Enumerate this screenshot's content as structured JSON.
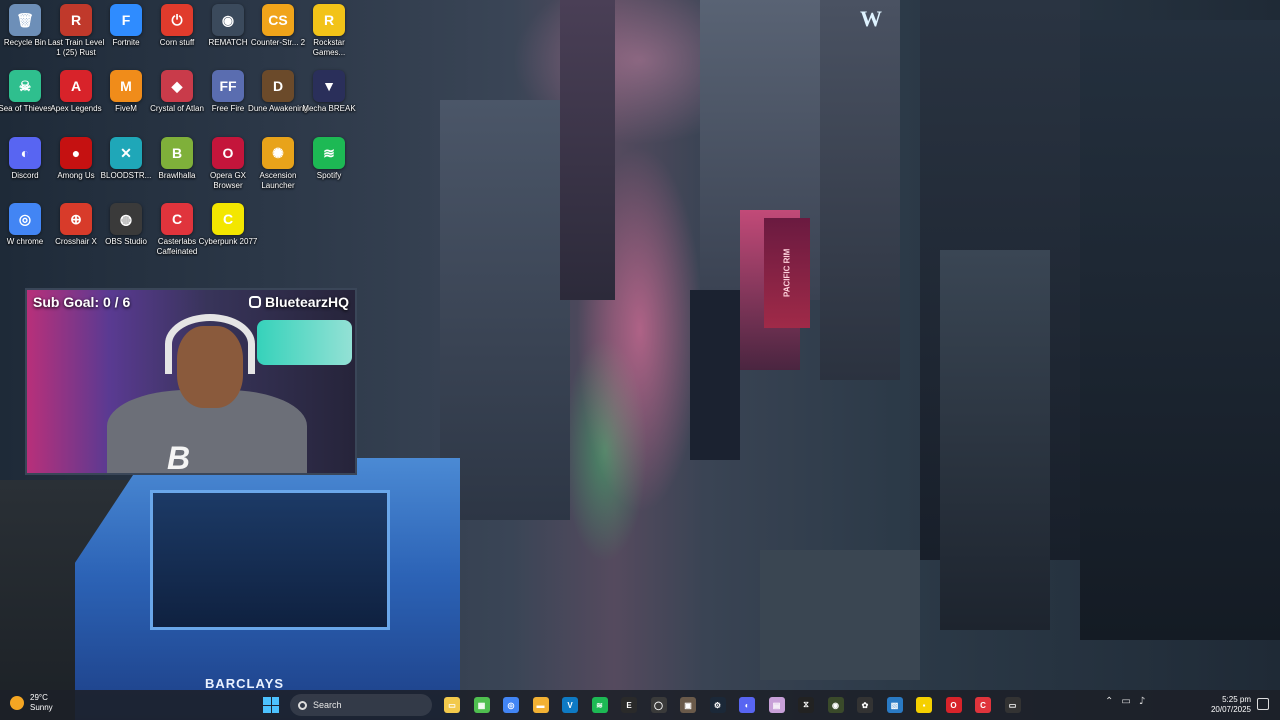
{
  "desktop": {
    "icons": [
      {
        "label": "Recycle Bin",
        "icon": "recycle-bin-icon",
        "color": "#6d8fb8",
        "glyph": "🗑"
      },
      {
        "label": "Last Train Level 1 (25) Rust",
        "icon": "rust-icon",
        "color": "#c0392b",
        "glyph": "R"
      },
      {
        "label": "Fortnite",
        "icon": "fortnite-icon",
        "color": "#2f8cff",
        "glyph": "F"
      },
      {
        "label": "Corn stuff",
        "icon": "power-icon",
        "color": "#e03b2c",
        "glyph": "⏻"
      },
      {
        "label": "REMATCH",
        "icon": "rematch-icon",
        "color": "#3b4a5c",
        "glyph": "◉"
      },
      {
        "label": "Counter-Str... 2",
        "icon": "counter-strike-icon",
        "color": "#f0a41a",
        "glyph": "CS"
      },
      {
        "label": "Rockstar Games...",
        "icon": "rockstar-icon",
        "color": "#f2c318",
        "glyph": "R"
      },
      {
        "label": "Sea of Thieves",
        "icon": "sea-of-thieves-icon",
        "color": "#2fbf8e",
        "glyph": "☠"
      },
      {
        "label": "Apex Legends",
        "icon": "apex-icon",
        "color": "#d8232a",
        "glyph": "A"
      },
      {
        "label": "FiveM",
        "icon": "fivem-icon",
        "color": "#f08c1a",
        "glyph": "M"
      },
      {
        "label": "Crystal of Atlan",
        "icon": "crystal-icon",
        "color": "#c93b4a",
        "glyph": "◆"
      },
      {
        "label": "Free Fire",
        "icon": "free-fire-icon",
        "color": "#5a6db0",
        "glyph": "FF"
      },
      {
        "label": "Dune Awakening",
        "icon": "dune-icon",
        "color": "#6b4a2a",
        "glyph": "D"
      },
      {
        "label": "Mecha BREAK",
        "icon": "mecha-break-icon",
        "color": "#2a2f5a",
        "glyph": "▼"
      },
      {
        "label": "Discord",
        "icon": "discord-icon",
        "color": "#5865f2",
        "glyph": "◐"
      },
      {
        "label": "Among Us",
        "icon": "among-us-icon",
        "color": "#c51111",
        "glyph": "●"
      },
      {
        "label": "BLOODSTR...",
        "icon": "bloodstrike-icon",
        "color": "#1fa7b8",
        "glyph": "✕"
      },
      {
        "label": "Brawlhalla",
        "icon": "brawlhalla-icon",
        "color": "#7fb03a",
        "glyph": "B"
      },
      {
        "label": "Opera GX Browser",
        "icon": "opera-gx-icon",
        "color": "#c4153b",
        "glyph": "O"
      },
      {
        "label": "Ascension Launcher",
        "icon": "ascension-icon",
        "color": "#e8a31a",
        "glyph": "✺"
      },
      {
        "label": "Spotify",
        "icon": "spotify-icon",
        "color": "#1db954",
        "glyph": "≋"
      },
      {
        "label": "W chrome",
        "icon": "chrome-icon",
        "color": "#4285f4",
        "glyph": "◎"
      },
      {
        "label": "Crosshair X",
        "icon": "crosshair-icon",
        "color": "#d83b2a",
        "glyph": "⊕"
      },
      {
        "label": "OBS Studio",
        "icon": "obs-icon",
        "color": "#3a3a3a",
        "glyph": "◍"
      },
      {
        "label": "Casterlabs Caffeinated",
        "icon": "casterlabs-icon",
        "color": "#e0343c",
        "glyph": "C"
      },
      {
        "label": "Cyberpunk 2077",
        "icon": "cyberpunk-icon",
        "color": "#f3e600",
        "glyph": "C"
      }
    ]
  },
  "wallpaper": {
    "billboard": "PACIFIC RIM",
    "bank_sign": "BARCLAYS",
    "hotel_sign": "W"
  },
  "overlay": {
    "sub_goal": "Sub Goal: 0 / 6",
    "handle": "BluetearzHQ",
    "logo_letter": "B"
  },
  "taskbar": {
    "weather_temp": "29°C",
    "weather_desc": "Sunny",
    "search_placeholder": "Search",
    "time": "5:25 pm",
    "date": "20/07/2025",
    "apps": [
      {
        "icon": "file-explorer-icon",
        "color": "#f2c94c",
        "glyph": "▭"
      },
      {
        "icon": "terminal-icon",
        "color": "#4fbf4f",
        "glyph": "▦"
      },
      {
        "icon": "chrome-taskbar-icon",
        "color": "#4285f4",
        "glyph": "◎"
      },
      {
        "icon": "folder-icon",
        "color": "#f2b134",
        "glyph": "▬"
      },
      {
        "icon": "vscode-icon",
        "color": "#0e7ac4",
        "glyph": "V"
      },
      {
        "icon": "spotify-taskbar-icon",
        "color": "#1db954",
        "glyph": "≋"
      },
      {
        "icon": "epic-games-icon",
        "color": "#2a2a2a",
        "glyph": "E"
      },
      {
        "icon": "circle-app-icon",
        "color": "#3a3a3a",
        "glyph": "◯"
      },
      {
        "icon": "photo-icon",
        "color": "#6a5a4a",
        "glyph": "▣"
      },
      {
        "icon": "steam-icon",
        "color": "#1b2838",
        "glyph": "⚙"
      },
      {
        "icon": "discord-taskbar-icon",
        "color": "#5865f2",
        "glyph": "◐"
      },
      {
        "icon": "photos-icon",
        "color": "#c8a0d8",
        "glyph": "▤"
      },
      {
        "icon": "capcut-icon",
        "color": "#222",
        "glyph": "⧖"
      },
      {
        "icon": "xbox-icon",
        "color": "#3a4a2a",
        "glyph": "◉"
      },
      {
        "icon": "chatgpt-icon",
        "color": "#333",
        "glyph": "✿"
      },
      {
        "icon": "image-viewer-icon",
        "color": "#2a7ac4",
        "glyph": "▧"
      },
      {
        "icon": "sticky-notes-icon",
        "color": "#f5d000",
        "glyph": "▪"
      },
      {
        "icon": "opera-taskbar-icon",
        "color": "#d8232a",
        "glyph": "O"
      },
      {
        "icon": "casterlabs-taskbar-icon",
        "color": "#e0343c",
        "glyph": "C"
      },
      {
        "icon": "game-bar-icon",
        "color": "#333",
        "glyph": "▭"
      }
    ]
  }
}
